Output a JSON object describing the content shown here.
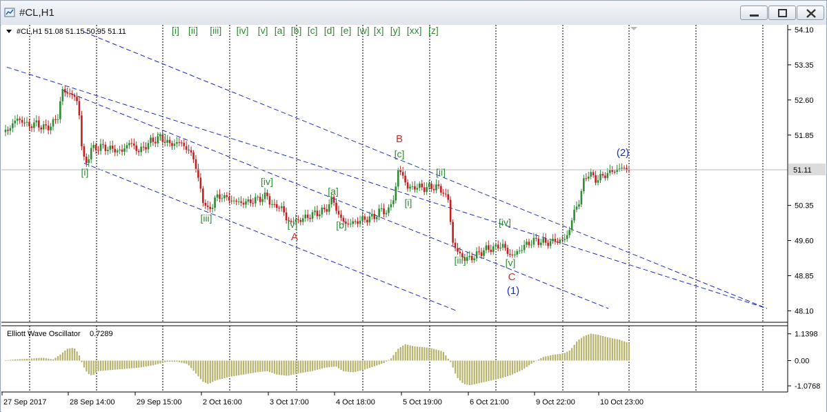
{
  "window": {
    "title": "#CL,H1",
    "buttons": [
      "minimize",
      "maximize",
      "close"
    ],
    "icons": {
      "app": "chart-window-icon"
    }
  },
  "symbol_info": {
    "text": "#CL,H1  51.08 51.15 50.95 51.11"
  },
  "wave_labels_bar": [
    "[i]",
    "[ii]",
    "[iii]",
    "[iv]",
    "[v]",
    "[a]",
    "[b]",
    "[c]",
    "[d]",
    "[e]",
    "[w]",
    "[x]",
    "[y]",
    "[xx]",
    "[z]"
  ],
  "colors": {
    "background": "#ffffff",
    "candle_up": "#2e8b32",
    "candle_down": "#c0201f",
    "channel": "#1c2fc8",
    "wave_green": "#2e8b32",
    "wave_red": "#c8322d",
    "wave_blue": "#1c2fb0",
    "oscillator": "#b7b36a",
    "price_label_bg": "#dcdcdc"
  },
  "chart_data": {
    "type": "candlestick",
    "symbol": "#CL",
    "timeframe": "H1",
    "ylim": [
      47.9,
      54.2
    ],
    "y_ticks": [
      "54.10",
      "53.35",
      "52.60",
      "51.85",
      "51.11",
      "50.35",
      "49.60",
      "48.85",
      "48.10"
    ],
    "current_price": "51.11",
    "x_labels": [
      "27 Sep 2017",
      "28 Sep 14:00",
      "29 Sep 15:00",
      "2 Oct 16:00",
      "3 Oct 17:00",
      "4 Oct 18:00",
      "5 Oct 19:00",
      "6 Oct 21:00",
      "9 Oct 22:00",
      "10 Oct 23:00"
    ],
    "price_path": [
      [
        0,
        51.85
      ],
      [
        12,
        52.0
      ],
      [
        22,
        52.2
      ],
      [
        30,
        52.15
      ],
      [
        40,
        52.05
      ],
      [
        52,
        52.1
      ],
      [
        60,
        52.0
      ],
      [
        72,
        52.05
      ],
      [
        82,
        52.25
      ],
      [
        88,
        52.8
      ],
      [
        96,
        52.75
      ],
      [
        104,
        52.7
      ],
      [
        112,
        52.5
      ],
      [
        117,
        51.5
      ],
      [
        122,
        51.2
      ],
      [
        130,
        51.55
      ],
      [
        145,
        51.6
      ],
      [
        160,
        51.55
      ],
      [
        175,
        51.5
      ],
      [
        185,
        51.7
      ],
      [
        200,
        51.5
      ],
      [
        215,
        51.7
      ],
      [
        230,
        51.8
      ],
      [
        245,
        51.65
      ],
      [
        260,
        51.7
      ],
      [
        272,
        51.5
      ],
      [
        280,
        51.35
      ],
      [
        285,
        50.9
      ],
      [
        292,
        50.5
      ],
      [
        300,
        50.2
      ],
      [
        310,
        50.5
      ],
      [
        320,
        50.55
      ],
      [
        335,
        50.45
      ],
      [
        350,
        50.4
      ],
      [
        365,
        50.45
      ],
      [
        375,
        50.5
      ],
      [
        385,
        50.55
      ],
      [
        395,
        50.3
      ],
      [
        405,
        50.35
      ],
      [
        413,
        50.05
      ],
      [
        420,
        50.0
      ],
      [
        435,
        50.05
      ],
      [
        450,
        50.15
      ],
      [
        460,
        50.2
      ],
      [
        470,
        50.25
      ],
      [
        480,
        50.5
      ],
      [
        490,
        50.1
      ],
      [
        500,
        49.95
      ],
      [
        510,
        49.98
      ],
      [
        525,
        50.05
      ],
      [
        540,
        50.1
      ],
      [
        550,
        50.25
      ],
      [
        560,
        50.2
      ],
      [
        570,
        50.55
      ],
      [
        575,
        51.1
      ],
      [
        580,
        51.05
      ],
      [
        590,
        50.7
      ],
      [
        600,
        50.75
      ],
      [
        615,
        50.72
      ],
      [
        630,
        50.75
      ],
      [
        640,
        50.65
      ],
      [
        648,
        50.45
      ],
      [
        655,
        49.5
      ],
      [
        662,
        49.35
      ],
      [
        672,
        49.2
      ],
      [
        685,
        49.25
      ],
      [
        700,
        49.4
      ],
      [
        715,
        49.45
      ],
      [
        728,
        49.5
      ],
      [
        735,
        49.3
      ],
      [
        745,
        49.3
      ],
      [
        755,
        49.45
      ],
      [
        765,
        49.55
      ],
      [
        775,
        49.6
      ],
      [
        790,
        49.55
      ],
      [
        805,
        49.6
      ],
      [
        815,
        49.6
      ],
      [
        822,
        49.75
      ],
      [
        830,
        50.2
      ],
      [
        838,
        50.45
      ],
      [
        845,
        50.9
      ],
      [
        852,
        51.05
      ],
      [
        860,
        50.9
      ],
      [
        870,
        50.95
      ],
      [
        880,
        51.05
      ],
      [
        890,
        51.1
      ],
      [
        900,
        51.15
      ],
      [
        910,
        51.11
      ]
    ],
    "wave_labels": [
      {
        "text": "[i]",
        "x": 121,
        "p": 51.06,
        "color": "green"
      },
      {
        "text": "[ii]",
        "x": 232,
        "p": 51.8,
        "color": "green"
      },
      {
        "text": "[iii]",
        "x": 297,
        "p": 50.08,
        "color": "green"
      },
      {
        "text": "[iv]",
        "x": 385,
        "p": 50.86,
        "color": "green"
      },
      {
        "text": "[v]",
        "x": 422,
        "p": 49.95,
        "color": "green"
      },
      {
        "text": "A",
        "x": 425,
        "p": 49.68,
        "color": "red"
      },
      {
        "text": "[a]",
        "x": 481,
        "p": 50.65,
        "color": "green"
      },
      {
        "text": "[b]",
        "x": 493,
        "p": 49.93,
        "color": "green"
      },
      {
        "text": "B",
        "x": 577,
        "p": 51.77,
        "color": "red"
      },
      {
        "text": "[c]",
        "x": 577,
        "p": 51.45,
        "color": "green"
      },
      {
        "text": "[i]",
        "x": 590,
        "p": 50.41,
        "color": "green"
      },
      {
        "text": "[ii]",
        "x": 637,
        "p": 51.06,
        "color": "green"
      },
      {
        "text": "[iii]",
        "x": 665,
        "p": 49.18,
        "color": "green"
      },
      {
        "text": "[iv]",
        "x": 730,
        "p": 49.99,
        "color": "green"
      },
      {
        "text": "[v]",
        "x": 738,
        "p": 49.13,
        "color": "green"
      },
      {
        "text": "C",
        "x": 740,
        "p": 48.83,
        "color": "red"
      },
      {
        "text": "(1)",
        "x": 742,
        "p": 48.53,
        "color": "blue"
      },
      {
        "text": "(2)",
        "x": 901,
        "p": 51.48,
        "color": "blue"
      }
    ],
    "channels": [
      {
        "from": [
          8,
          53.3
        ],
        "to": [
          1110,
          48.15
        ]
      },
      {
        "from": [
          120,
          54.05
        ],
        "to": [
          1110,
          48.15
        ]
      },
      {
        "from": [
          120,
          51.25
        ],
        "to": [
          660,
          48.1
        ]
      },
      {
        "from": [
          90,
          52.8
        ],
        "to": [
          880,
          48.15
        ]
      }
    ],
    "oscillator": {
      "name": "Elliott Wave Oscillator",
      "value": "0.7289",
      "y_ticks": [
        "1.1398",
        "0.00",
        "-1.0768"
      ],
      "ylim": [
        -1.3,
        1.3
      ],
      "series": [
        [
          0,
          0.0
        ],
        [
          20,
          0.05
        ],
        [
          40,
          0.08
        ],
        [
          60,
          0.12
        ],
        [
          75,
          0.05
        ],
        [
          85,
          0.25
        ],
        [
          95,
          0.5
        ],
        [
          105,
          0.55
        ],
        [
          112,
          0.3
        ],
        [
          118,
          -0.2
        ],
        [
          125,
          -0.55
        ],
        [
          132,
          -0.65
        ],
        [
          140,
          -0.45
        ],
        [
          160,
          -0.4
        ],
        [
          180,
          -0.35
        ],
        [
          200,
          -0.3
        ],
        [
          220,
          -0.2
        ],
        [
          240,
          -0.05
        ],
        [
          255,
          -0.05
        ],
        [
          270,
          -0.15
        ],
        [
          282,
          -0.55
        ],
        [
          292,
          -0.9
        ],
        [
          300,
          -1.0
        ],
        [
          310,
          -0.85
        ],
        [
          330,
          -0.7
        ],
        [
          350,
          -0.6
        ],
        [
          370,
          -0.5
        ],
        [
          385,
          -0.45
        ],
        [
          400,
          -0.6
        ],
        [
          415,
          -0.65
        ],
        [
          430,
          -0.55
        ],
        [
          450,
          -0.45
        ],
        [
          470,
          -0.3
        ],
        [
          485,
          -0.25
        ],
        [
          495,
          -0.45
        ],
        [
          510,
          -0.5
        ],
        [
          525,
          -0.4
        ],
        [
          540,
          -0.25
        ],
        [
          555,
          -0.1
        ],
        [
          565,
          0.1
        ],
        [
          575,
          0.5
        ],
        [
          585,
          0.7
        ],
        [
          600,
          0.6
        ],
        [
          620,
          0.55
        ],
        [
          640,
          0.4
        ],
        [
          652,
          -0.1
        ],
        [
          660,
          -0.7
        ],
        [
          670,
          -1.0
        ],
        [
          680,
          -1.05
        ],
        [
          695,
          -0.95
        ],
        [
          710,
          -0.85
        ],
        [
          725,
          -0.75
        ],
        [
          740,
          -0.6
        ],
        [
          755,
          -0.4
        ],
        [
          770,
          -0.1
        ],
        [
          785,
          0.15
        ],
        [
          800,
          0.25
        ],
        [
          815,
          0.3
        ],
        [
          825,
          0.45
        ],
        [
          835,
          0.85
        ],
        [
          845,
          1.05
        ],
        [
          855,
          1.15
        ],
        [
          865,
          1.1
        ],
        [
          880,
          0.98
        ],
        [
          895,
          0.9
        ],
        [
          910,
          0.75
        ]
      ]
    },
    "grid": "vertical dotted"
  }
}
